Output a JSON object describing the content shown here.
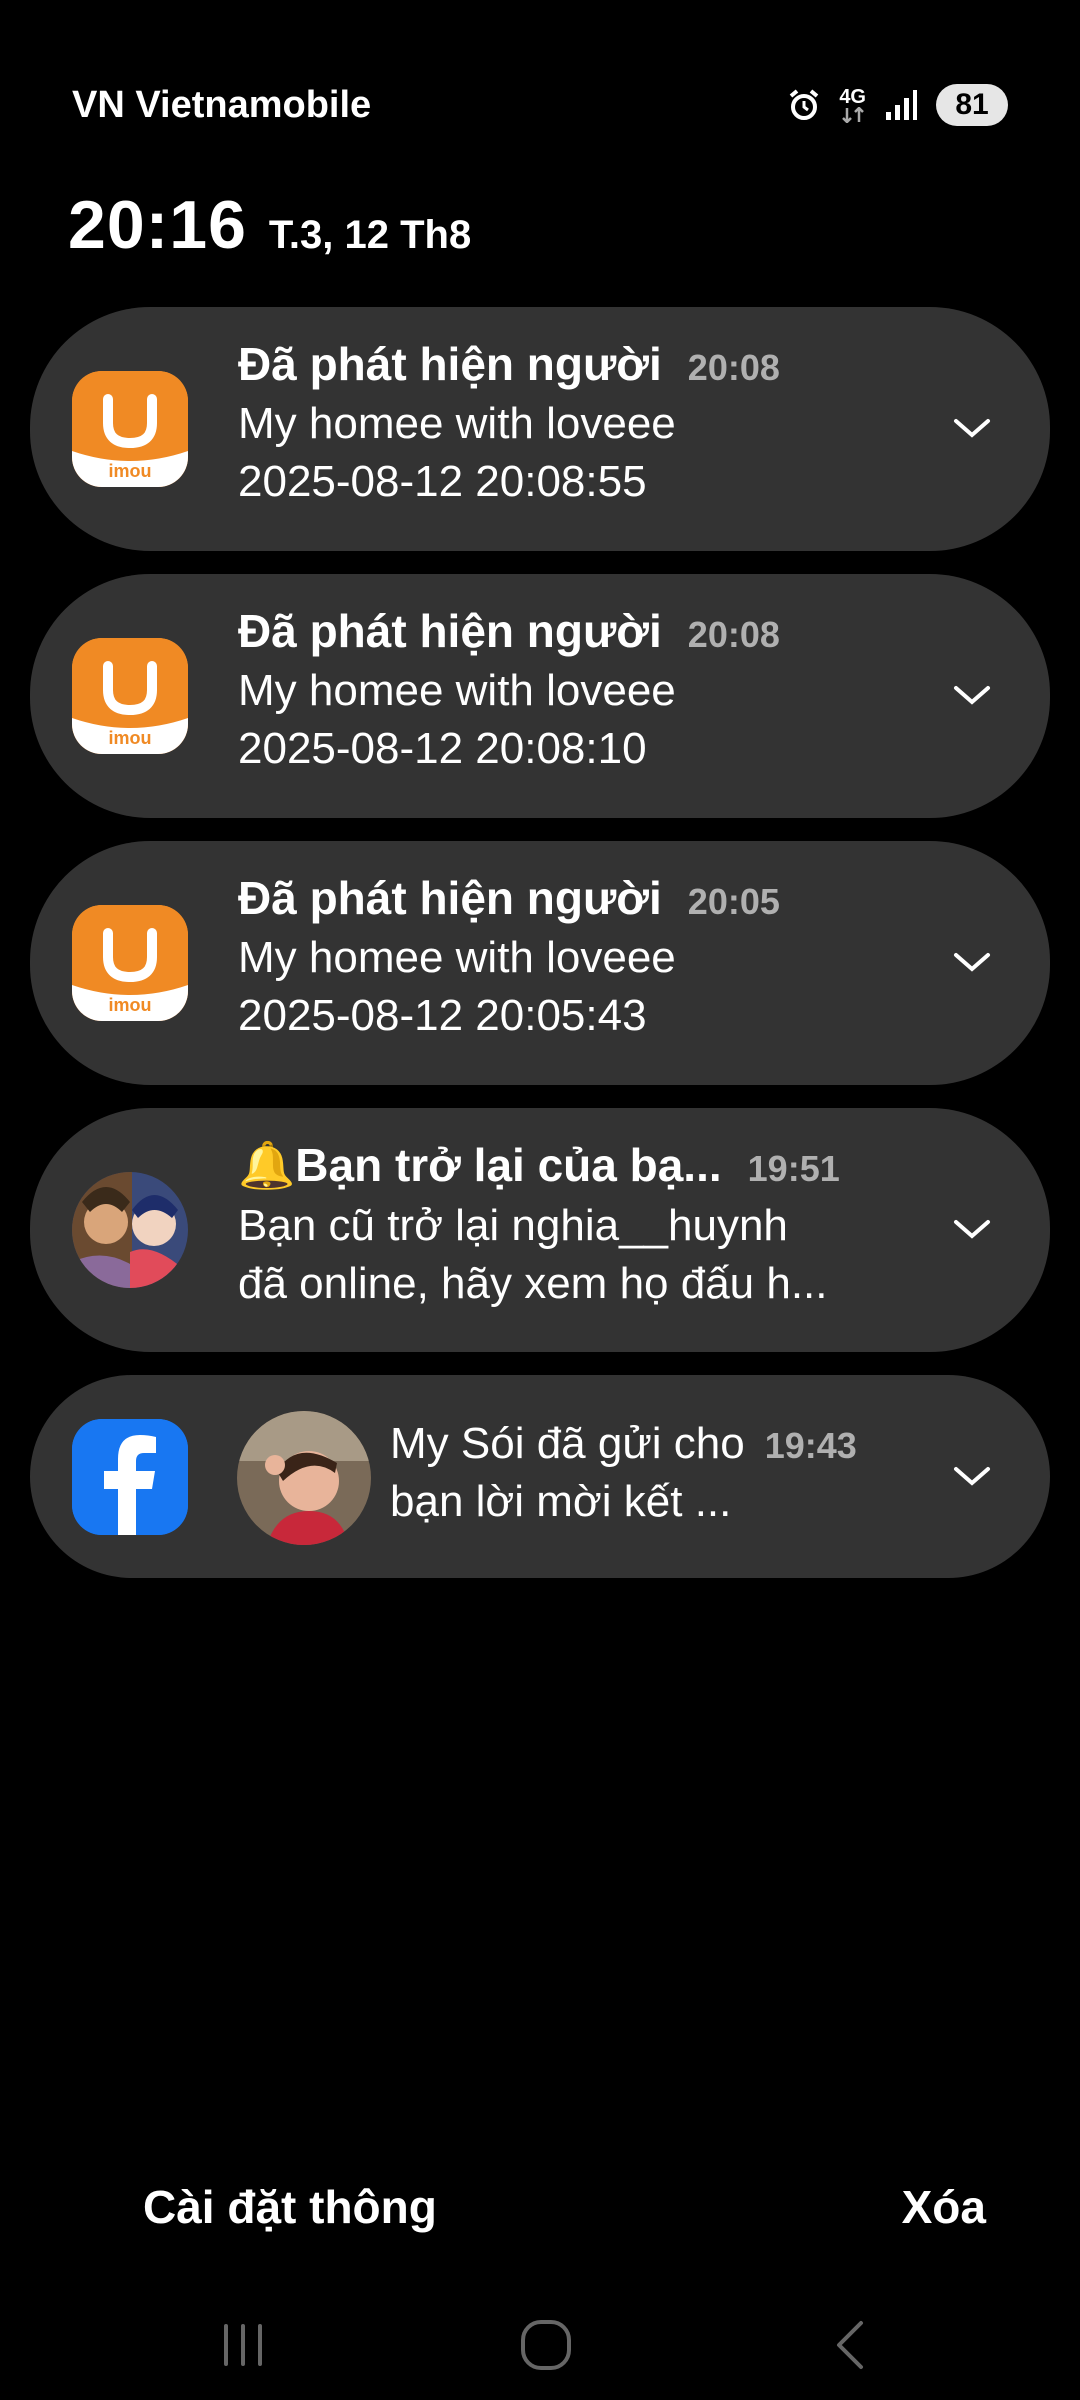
{
  "status": {
    "carrier": "VN Vietnamobile",
    "network": "4G",
    "battery": "81",
    "icons": [
      "alarm-icon",
      "network-4g-icon",
      "signal-icon",
      "battery-icon"
    ]
  },
  "header": {
    "time": "20:16",
    "date": "T.3, 12 Th8"
  },
  "notifications": [
    {
      "app": "imou",
      "title": "Đã phát hiện người",
      "time": "20:08",
      "line1": "My homee with loveee",
      "line2": "2025-08-12 20:08:55"
    },
    {
      "app": "imou",
      "title": "Đã phát hiện người",
      "time": "20:08",
      "line1": "My homee with loveee",
      "line2": "2025-08-12 20:08:10"
    },
    {
      "app": "imou",
      "title": "Đã phát hiện người",
      "time": "20:05",
      "line1": "My homee with loveee",
      "line2": "2025-08-12 20:05:43"
    },
    {
      "app": "game",
      "title": "🔔Bạn trở lại của bạ...",
      "time": "19:51",
      "line1": "Bạn cũ trở lại nghia__huynh",
      "line2": "đã online, hãy xem họ đấu h..."
    },
    {
      "app": "facebook",
      "line1": "My Sói đã gửi cho",
      "line2": "bạn lời mời kết ...",
      "time": "19:43"
    }
  ],
  "actions": {
    "settings_label": "Cài đặt thông",
    "clear_label": "Xóa"
  },
  "colors": {
    "background": "#000000",
    "card": "#333333",
    "imou_orange": "#f08a24",
    "facebook_blue": "#1877f2",
    "time_gray": "#b0b0b0"
  }
}
